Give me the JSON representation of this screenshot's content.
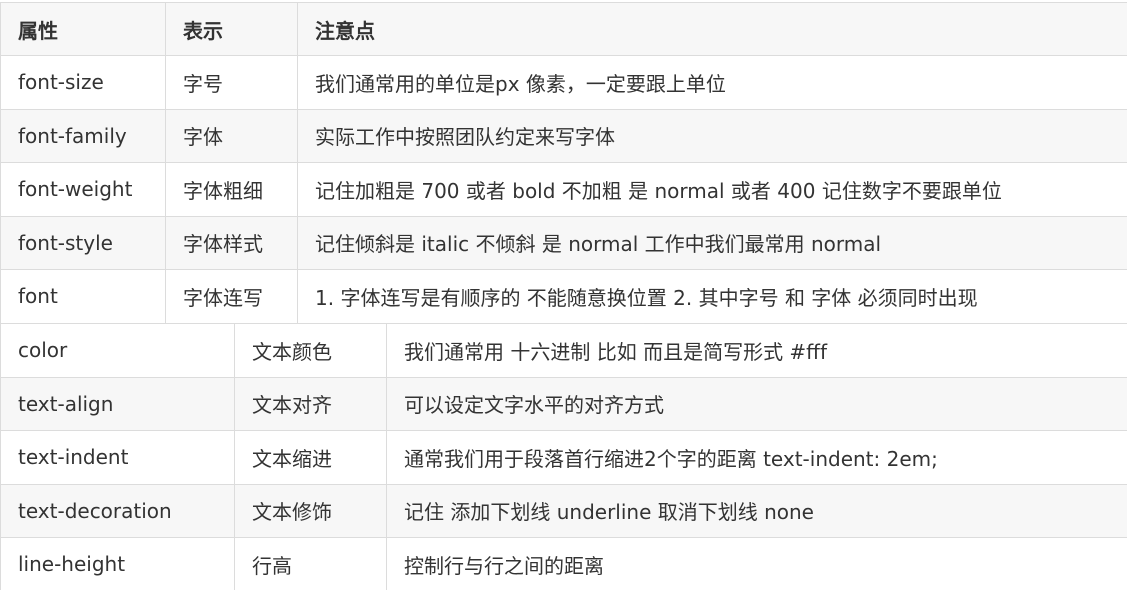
{
  "table1": {
    "headers": [
      "属性",
      "表示",
      "注意点"
    ],
    "rows": [
      [
        "font-size",
        "字号",
        "我们通常用的单位是px 像素，一定要跟上单位"
      ],
      [
        "font-family",
        "字体",
        "实际工作中按照团队约定来写字体"
      ],
      [
        "font-weight",
        "字体粗细",
        "记住加粗是 700 或者 bold  不加粗 是 normal 或者  400  记住数字不要跟单位"
      ],
      [
        "font-style",
        "字体样式",
        "记住倾斜是 italic     不倾斜 是 normal  工作中我们最常用 normal"
      ],
      [
        "font",
        "字体连写",
        "1. 字体连写是有顺序的  不能随意换位置 2. 其中字号 和 字体 必须同时出现"
      ]
    ]
  },
  "table2": {
    "rows": [
      [
        "color",
        "文本颜色",
        "我们通常用  十六进制   比如 而且是简写形式 #fff"
      ],
      [
        "text-align",
        "文本对齐",
        "可以设定文字水平的对齐方式"
      ],
      [
        "text-indent",
        "文本缩进",
        "通常我们用于段落首行缩进2个字的距离    text-indent: 2em;"
      ],
      [
        "text-decoration",
        "文本修饰",
        "记住 添加下划线  underline  取消下划线  none"
      ],
      [
        "line-height",
        "行高",
        "控制行与行之间的距离"
      ]
    ]
  }
}
